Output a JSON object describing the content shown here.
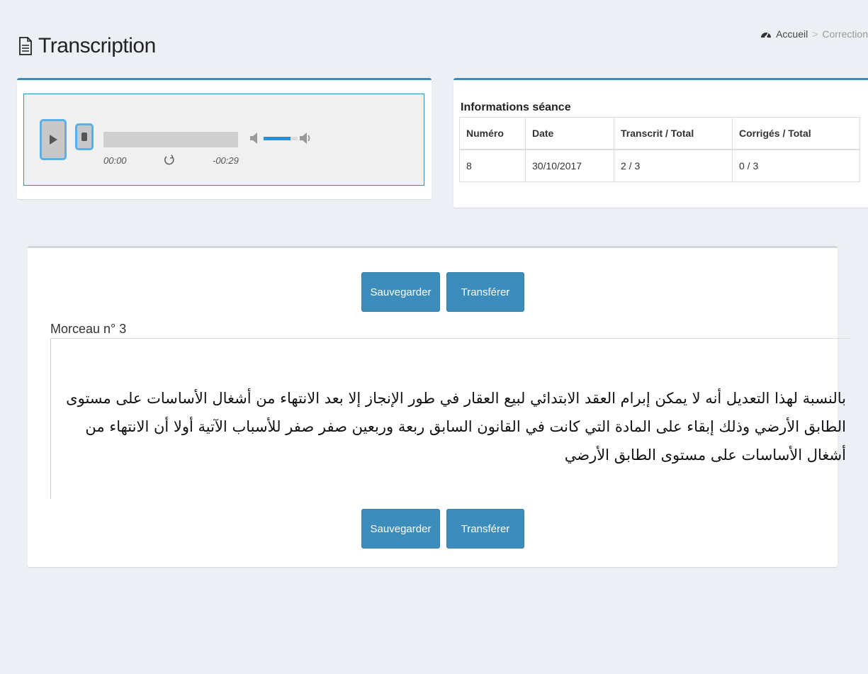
{
  "header": {
    "title": "Transcription",
    "title_icon": "file-text-icon"
  },
  "breadcrumb": {
    "home": "Accueil",
    "home_icon": "dashboard-icon",
    "separator": ">",
    "current": "Correction"
  },
  "player": {
    "current_time": "00:00",
    "remaining_time": "-00:29",
    "volume_level": 0.8,
    "icons": [
      "play-icon",
      "stop-icon",
      "volume-low-icon",
      "volume-high-icon",
      "repeat-icon"
    ]
  },
  "info": {
    "title": "Informations séance",
    "headers": [
      "Numéro",
      "Date",
      "Transcrit / Total",
      "Corrigés / Total"
    ],
    "row": [
      "8",
      "30/10/2017",
      "2 / 3",
      "0 / 3"
    ]
  },
  "actions": {
    "save_label": "Sauvegarder",
    "transfer_label": "Transférer"
  },
  "segment": {
    "label": "Morceau n° 3",
    "text": "بالنسبة لهذا التعديل أنه لا يمكن إبرام العقد الابتدائي لبيع العقار في طور الإنجاز إلا بعد الانتهاء من أشغال الأساسات على مستوى الطابق الأرضي وذلك إبقاء على المادة التي كانت في القانون السابق ربعة وربعين صفر صفر للأسباب الآتية أولا أن الانتهاء من أشغال الأساسات على مستوى الطابق الأرضي"
  },
  "colors": {
    "primary": "#3c8dbc",
    "background": "#ecf0f5",
    "volume": "#2c8fd6"
  }
}
